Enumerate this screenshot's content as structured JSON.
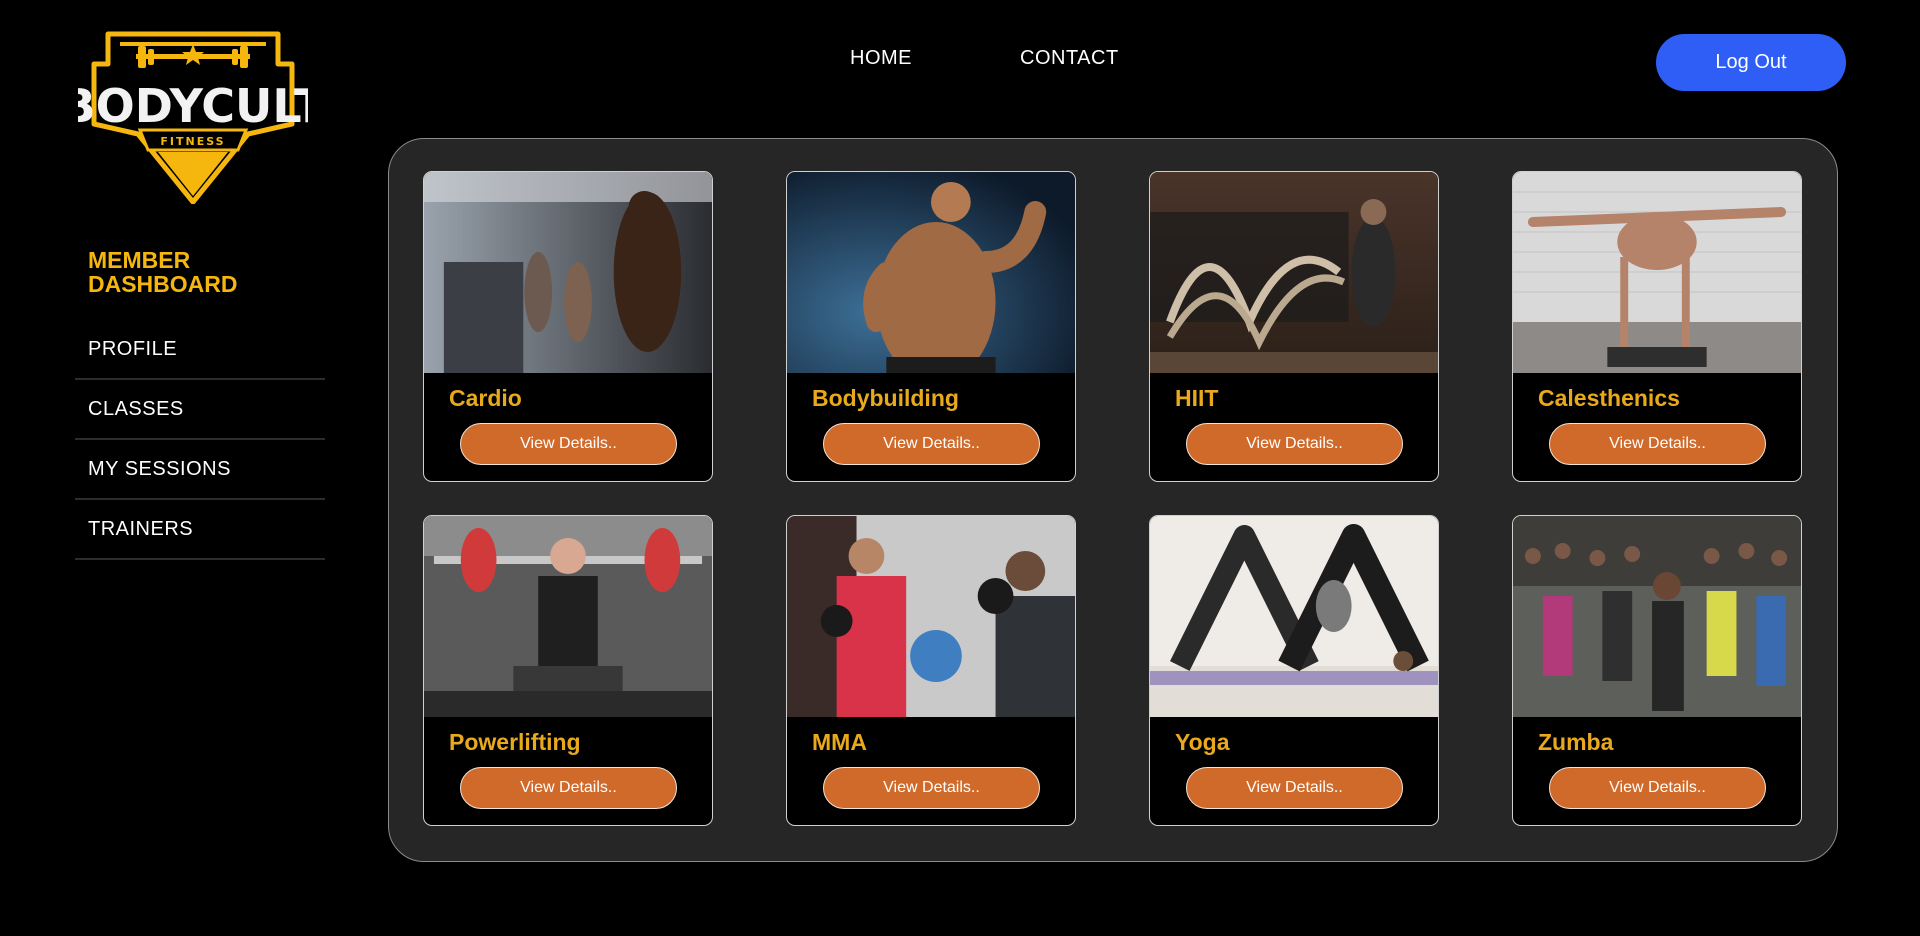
{
  "brand": {
    "name": "BODYCULT",
    "tagline": "FITNESS",
    "logo_color": "#f5b60e"
  },
  "sidebar": {
    "title_line1": "MEMBER",
    "title_line2": "DASHBOARD",
    "items": [
      {
        "label": "PROFILE"
      },
      {
        "label": "CLASSES"
      },
      {
        "label": "MY SESSIONS"
      },
      {
        "label": "TRAINERS"
      }
    ]
  },
  "nav": {
    "home": "HOME",
    "contact": "CONTACT",
    "logout": "Log Out"
  },
  "classes": [
    {
      "title": "Cardio",
      "button": "View Details.."
    },
    {
      "title": "Bodybuilding",
      "button": "View Details.."
    },
    {
      "title": "HIIT",
      "button": "View Details.."
    },
    {
      "title": "Calesthenics",
      "button": "View Details.."
    },
    {
      "title": "Powerlifting",
      "button": "View Details.."
    },
    {
      "title": "MMA",
      "button": "View Details.."
    },
    {
      "title": "Yoga",
      "button": "View Details.."
    },
    {
      "title": "Zumba",
      "button": "View Details.."
    }
  ],
  "colors": {
    "accent": "#f5b60e",
    "title_gold": "#e9a91d",
    "button_orange": "#cf6a2a",
    "logout_blue": "#2f5ef6",
    "panel_bg": "#262626"
  }
}
